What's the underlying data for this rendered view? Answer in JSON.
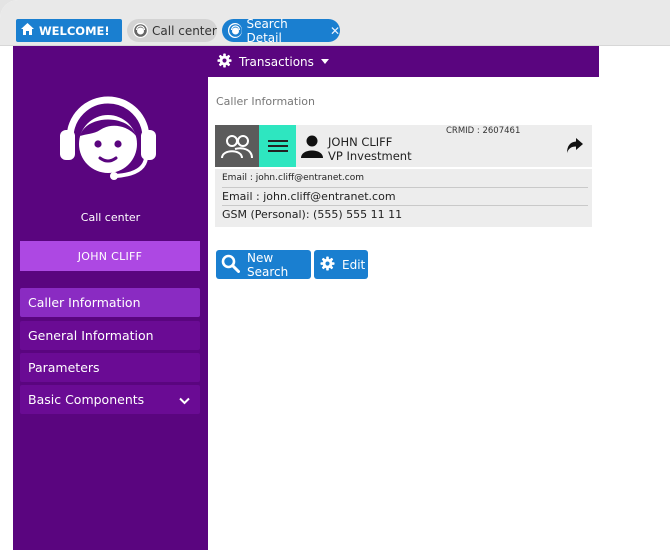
{
  "tabs": {
    "welcome": "WELCOME!",
    "call_center": "Call center",
    "search_detail": "Search Detail",
    "close_glyph": "✕"
  },
  "sidebar": {
    "label": "Call center",
    "user_name": "JOHN CLIFF",
    "items": [
      {
        "label": "Caller Information",
        "active": true
      },
      {
        "label": "General Information"
      },
      {
        "label": "Parameters"
      },
      {
        "label": "Basic Components",
        "has_chevron": true
      }
    ]
  },
  "transactions_menu": {
    "label": "Transactions"
  },
  "main": {
    "section_title": "Caller Information",
    "caller": {
      "name": "JOHN CLIFF",
      "role": "VP Investment",
      "crm_id": "CRMID : 2607461"
    },
    "details": {
      "email_small": "Email : john.cliff@entranet.com",
      "email": "Email : john.cliff@entranet.com",
      "gsm": "GSM (Personal): (555) 555 11 11"
    },
    "buttons": {
      "new_search": "New Search",
      "edit": "Edit"
    }
  },
  "colors": {
    "brand_purple": "#5a057f",
    "accent_blue": "#1a7fd0",
    "user_box": "#ad48e3",
    "teal": "#2ee6c0"
  },
  "icons": [
    "home-icon",
    "agent-avatar-icon",
    "headset-agent-logo-icon",
    "gear-icon",
    "users-icon",
    "list-icon",
    "person-icon",
    "share-icon",
    "search-icon",
    "chevron-down-icon"
  ]
}
